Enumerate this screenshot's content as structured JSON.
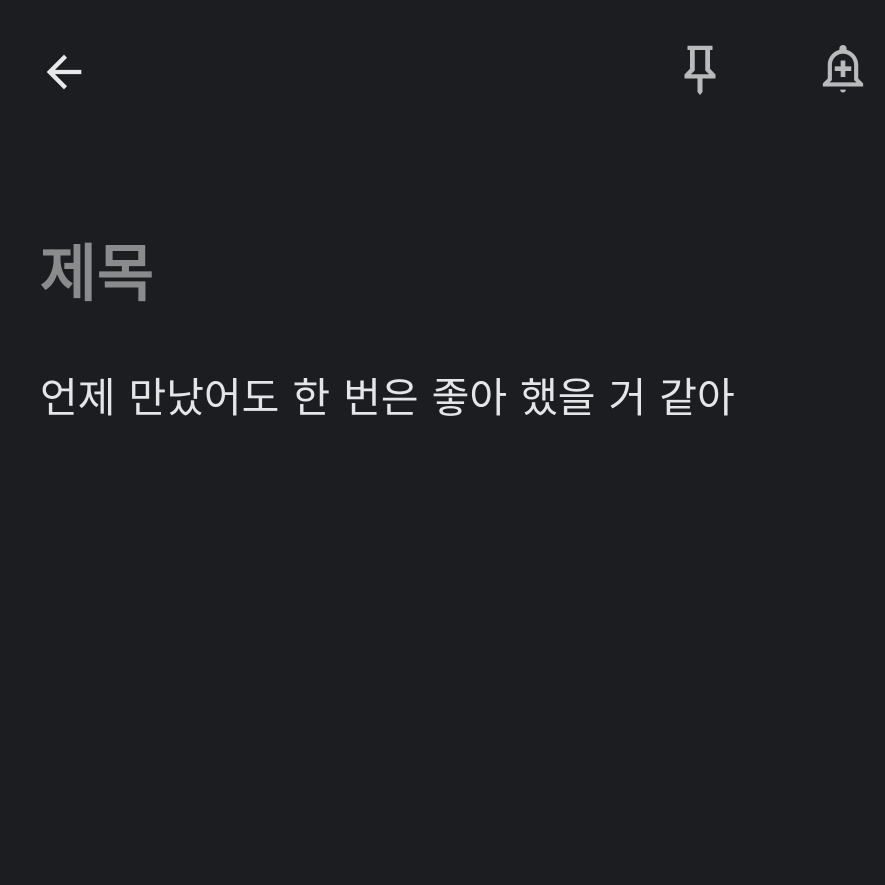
{
  "toolbar": {
    "back_icon": "arrow-left-icon",
    "pin_icon": "pin-icon",
    "reminder_icon": "bell-plus-icon"
  },
  "note": {
    "title_placeholder": "제목",
    "body": "언제 만났어도 한 번은 좋아 했을 거 같아"
  },
  "colors": {
    "background": "#1b1d21",
    "icon_primary": "#e8e9eb",
    "icon_secondary": "#b9babc",
    "title_placeholder": "#8a8b8d",
    "body_text": "#e4e5e7"
  }
}
